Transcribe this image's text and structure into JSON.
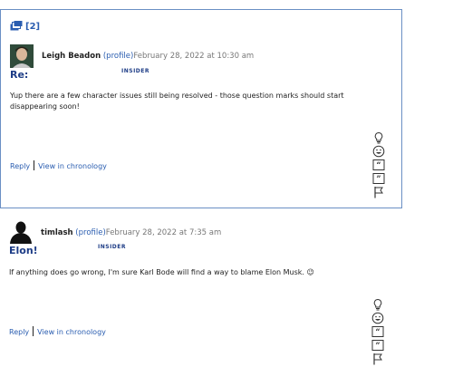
{
  "comments": [
    {
      "thread_count": "[2]",
      "author": "Leigh Beadon",
      "profile_label": "(profile)",
      "date": "February 28, 2022 at 10:30 am",
      "badge": "INSIDER",
      "title": "Re:",
      "body": "Yup there are a few character issues still being resolved - those question marks should start disappearing soon!",
      "reply": "Reply",
      "chronology": "View in chronology"
    },
    {
      "author": "timlash",
      "profile_label": "(profile)",
      "date": "February 28, 2022 at 7:35 am",
      "badge": "INSIDER",
      "title": "Elon!",
      "body": "If anything does go wrong, I'm sure Karl Bode will find a way to blame Elon Musk. 😉",
      "reply": "Reply",
      "chronology": "View in chronology"
    }
  ],
  "vote_icons": [
    "insightful-icon",
    "funny-icon",
    "first-word-icon",
    "last-word-icon",
    "flag-icon"
  ]
}
